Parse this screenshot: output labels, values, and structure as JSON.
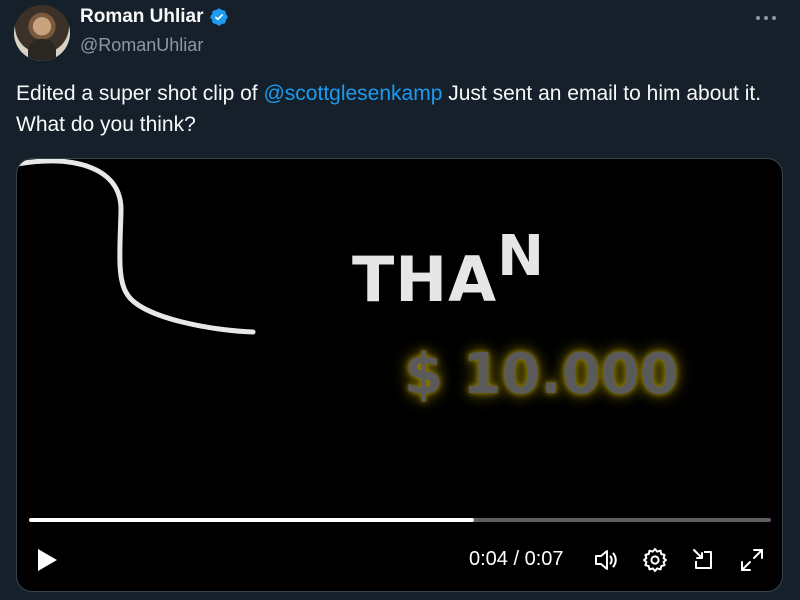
{
  "author": {
    "display_name": "Roman Uhliar",
    "handle": "@RomanUhliar",
    "verified": true
  },
  "tweet": {
    "text_before": "Edited a super shot clip of ",
    "mention": "@scottglesenkamp",
    "text_after": " Just sent an email to him about it. What do you think?"
  },
  "video": {
    "caption_main": "THA",
    "caption_raised": "N",
    "caption_amount": "$ 10.000",
    "current_time": "0:04",
    "separator": " / ",
    "duration": "0:07",
    "progress_fraction": 0.6
  },
  "icons": {
    "more": "more-horizontal-icon",
    "verified": "verified-badge-icon",
    "play": "play-icon",
    "volume": "volume-icon",
    "settings": "gear-icon",
    "dock": "picture-in-picture-icon",
    "fullscreen": "fullscreen-icon"
  },
  "colors": {
    "background": "#15202b",
    "mention": "#1d9bf0",
    "verified": "#1d9bf0",
    "secondary_text": "#8b98a5",
    "amount_glow": "#9e8a00"
  }
}
